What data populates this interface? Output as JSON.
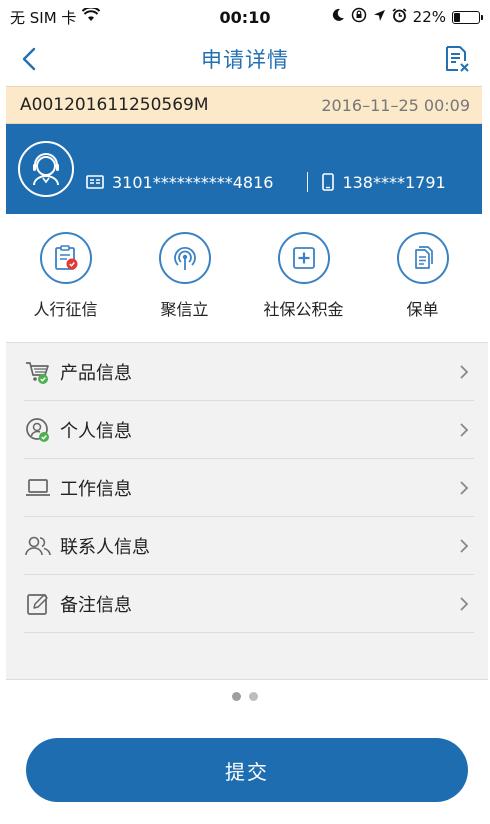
{
  "status_bar": {
    "carrier": "无 SIM 卡",
    "time": "00:10",
    "battery": "22%",
    "battery_level": 0.22
  },
  "nav": {
    "title": "申请详情"
  },
  "order": {
    "id": "A001201611250569M",
    "time": "2016–11–25 00:09"
  },
  "user": {
    "name": "",
    "id_number": "3101**********4816",
    "phone": "138****1791"
  },
  "quick_actions": [
    {
      "label": "人行征信",
      "icon": "credit-report-icon"
    },
    {
      "label": "聚信立",
      "icon": "aggregator-icon"
    },
    {
      "label": "社保公积金",
      "icon": "social-security-icon"
    },
    {
      "label": "保单",
      "icon": "insurance-policy-icon"
    }
  ],
  "list": [
    {
      "label": "产品信息",
      "icon": "cart-check-icon"
    },
    {
      "label": "个人信息",
      "icon": "person-check-icon"
    },
    {
      "label": "工作信息",
      "icon": "laptop-icon"
    },
    {
      "label": "联系人信息",
      "icon": "contacts-icon"
    },
    {
      "label": "备注信息",
      "icon": "edit-note-icon"
    }
  ],
  "pager": {
    "total": 2,
    "current": 0
  },
  "submit_label": "提交",
  "colors": {
    "primary": "#1e6db0",
    "title_blue": "#2370b2",
    "order_bg": "#fbe9c9",
    "check_green": "#4caf50",
    "stamp_red": "#e53935"
  }
}
